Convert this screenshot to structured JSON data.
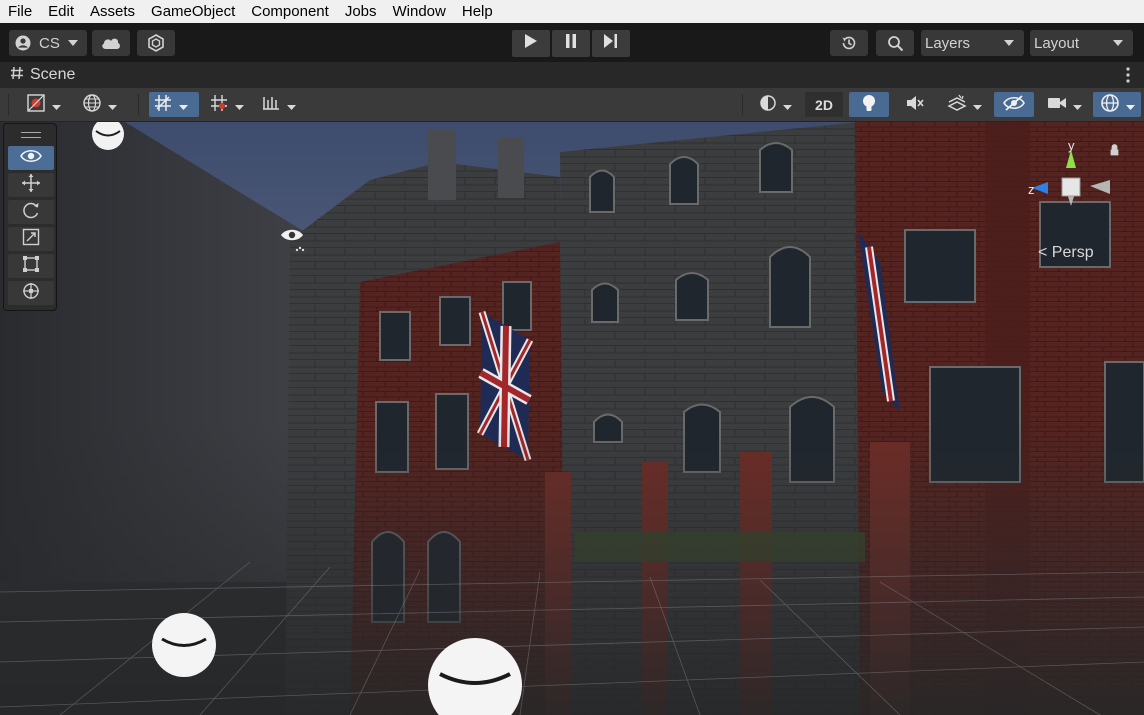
{
  "menu": [
    "File",
    "Edit",
    "Assets",
    "GameObject",
    "Component",
    "Jobs",
    "Window",
    "Help"
  ],
  "toolbar": {
    "account_label": "CS",
    "layers_label": "Layers",
    "layout_label": "Layout"
  },
  "scene_tab": {
    "title": "Scene"
  },
  "scene_bar": {
    "mode_2d_label": "2D"
  },
  "gizmo": {
    "y_label": "y",
    "z_label": "z",
    "projection_label": "< Persp"
  },
  "colors": {
    "accent_active": "#486a93",
    "gizmo_y": "#8de04a",
    "gizmo_z": "#2e7fe6",
    "brick": "#6b2a24"
  }
}
